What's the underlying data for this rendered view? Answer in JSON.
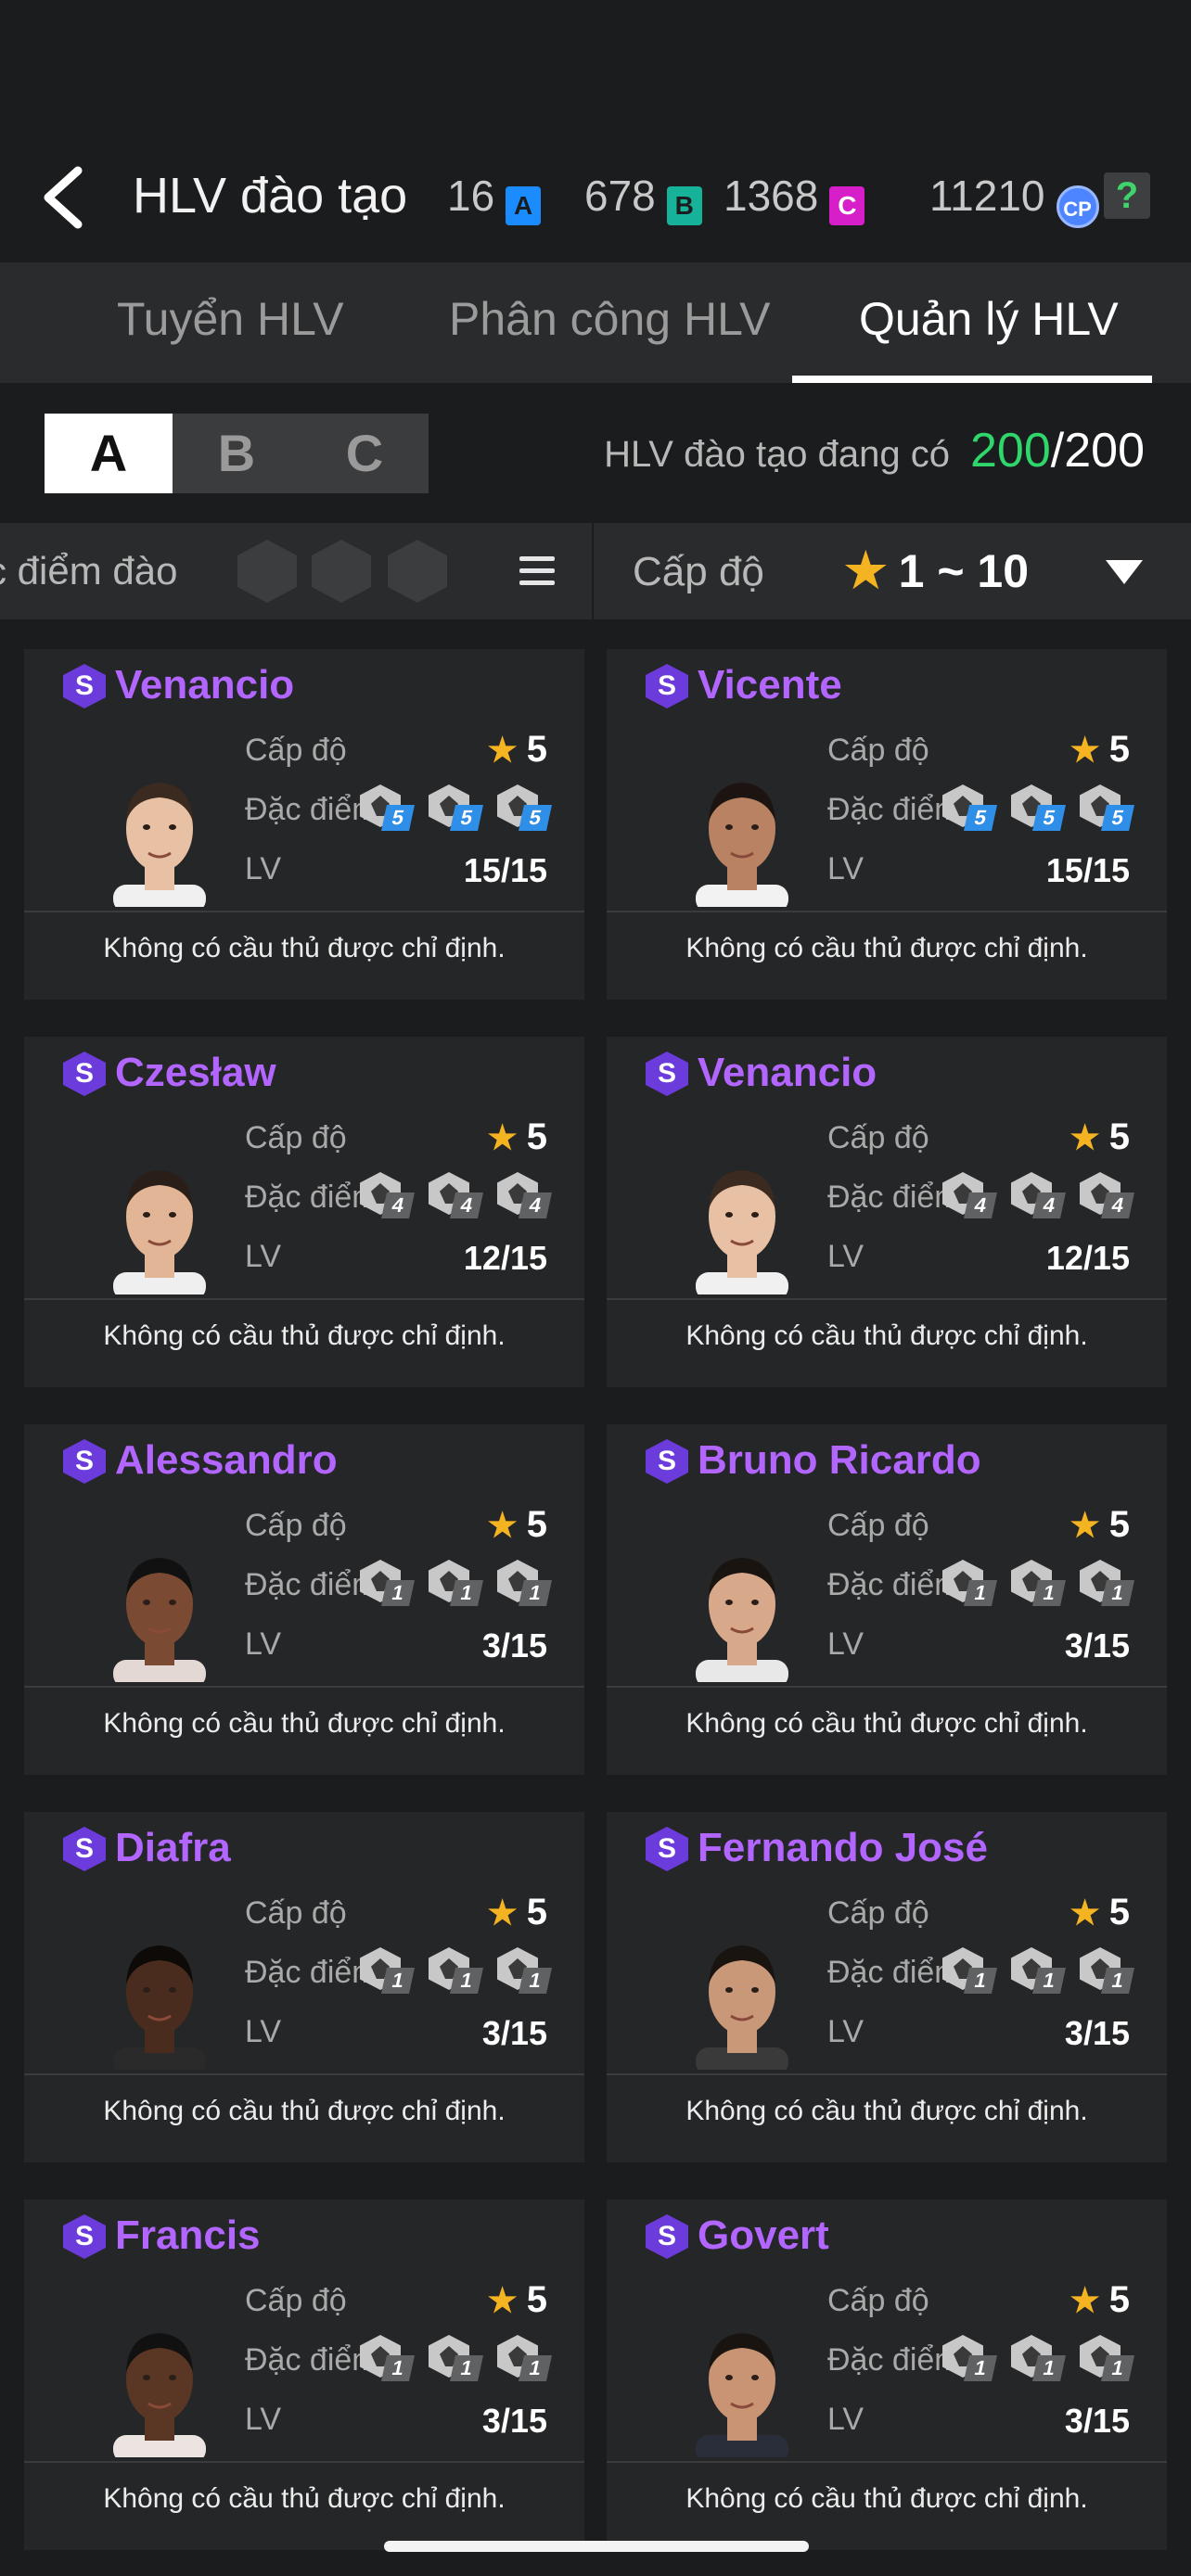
{
  "header": {
    "back_icon": "chevron-left-icon",
    "title": "HLV đào tạo",
    "currencies": [
      {
        "value": "16",
        "token": "A",
        "color": "#1a8cff"
      },
      {
        "value": "678",
        "token": "B",
        "color": "#16b39a"
      },
      {
        "value": "1368",
        "token": "C",
        "color": "#d61ec9"
      },
      {
        "value": "11210",
        "token": "CP",
        "color": "#4d84ff"
      }
    ],
    "help_label": "?"
  },
  "tabs": [
    {
      "label": "Tuyển HLV",
      "active": false
    },
    {
      "label": "Phân công HLV",
      "active": false
    },
    {
      "label": "Quản lý HLV",
      "active": true
    }
  ],
  "segments": [
    {
      "label": "A",
      "active": true
    },
    {
      "label": "B",
      "active": false
    },
    {
      "label": "C",
      "active": false
    }
  ],
  "coach_count": {
    "label": "HLV đào tạo đang có",
    "current": "200",
    "max": "/200"
  },
  "filter": {
    "trait_label": "c điểm đào",
    "menu_icon": "list-menu-icon",
    "level_label": "Cấp độ",
    "level_range": "1 ~ 10",
    "dropdown_icon": "triangle-down-icon"
  },
  "card_labels": {
    "level": "Cấp độ",
    "traits": "Đặc điểm",
    "lv": "LV",
    "no_player": "Không có cầu thủ được chỉ định.",
    "grade": "S"
  },
  "coaches": [
    {
      "name": "Venancio",
      "stars": "5",
      "lv": "15/15",
      "trait_level": "5",
      "skin": "#e8c0a4",
      "hair": "#3a2a20",
      "shirt": "#f0f0f0"
    },
    {
      "name": "Vicente",
      "stars": "5",
      "lv": "15/15",
      "trait_level": "5",
      "skin": "#b98262",
      "hair": "#1c1410",
      "shirt": "#f2f2f2"
    },
    {
      "name": "Czesław",
      "stars": "5",
      "lv": "12/15",
      "trait_level": "4",
      "skin": "#e1b596",
      "hair": "#2a1e18",
      "shirt": "#efefef"
    },
    {
      "name": "Venancio",
      "stars": "5",
      "lv": "12/15",
      "trait_level": "4",
      "skin": "#e8c0a4",
      "hair": "#3a2a20",
      "shirt": "#f0f0f0"
    },
    {
      "name": "Alessandro",
      "stars": "5",
      "lv": "3/15",
      "trait_level": "1",
      "skin": "#7a4a32",
      "hair": "#111111",
      "shirt": "#e4d8d4"
    },
    {
      "name": "Bruno Ricardo",
      "stars": "5",
      "lv": "3/15",
      "trait_level": "1",
      "skin": "#d7a88a",
      "hair": "#1a1410",
      "shirt": "#e8e8e8"
    },
    {
      "name": "Diafra",
      "stars": "5",
      "lv": "3/15",
      "trait_level": "1",
      "skin": "#4a2c1e",
      "hair": "#0e0a08",
      "shirt": "#2a2a2a"
    },
    {
      "name": "Fernando José",
      "stars": "5",
      "lv": "3/15",
      "trait_level": "1",
      "skin": "#c99878",
      "hair": "#1a1410",
      "shirt": "#3a3a3a"
    },
    {
      "name": "Francis",
      "stars": "5",
      "lv": "3/15",
      "trait_level": "1",
      "skin": "#5a3624",
      "hair": "#111111",
      "shirt": "#ece4e0"
    },
    {
      "name": "Govert",
      "stars": "5",
      "lv": "3/15",
      "trait_level": "1",
      "skin": "#c89474",
      "hair": "#1a1410",
      "shirt": "#2a2e3a"
    }
  ]
}
